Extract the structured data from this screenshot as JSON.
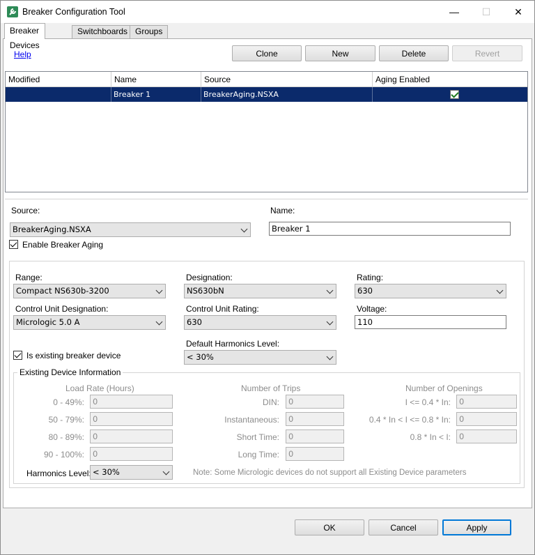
{
  "window": {
    "title": "Breaker Configuration Tool",
    "min_glyph": "—",
    "max_glyph": "☐",
    "close_glyph": "✕"
  },
  "tabs": [
    "Breaker Devices",
    "Switchboards",
    "Groups"
  ],
  "toolbar": {
    "help": "Help",
    "clone": "Clone",
    "new": "New",
    "delete": "Delete",
    "revert": "Revert"
  },
  "grid": {
    "columns": [
      "Modified",
      "Name",
      "Source",
      "Aging Enabled"
    ],
    "rows": [
      {
        "modified": "",
        "name": "Breaker 1",
        "source": "BreakerAging.NSXA",
        "aging_enabled": true
      }
    ]
  },
  "form": {
    "source_label": "Source:",
    "source_value": "BreakerAging.NSXA",
    "name_label": "Name:",
    "name_value": "Breaker 1",
    "enable_aging_label": "Enable Breaker Aging",
    "range_label": "Range:",
    "range_value": "Compact NS630b-3200",
    "designation_label": "Designation:",
    "designation_value": "NS630bN",
    "rating_label": "Rating:",
    "rating_value": "630",
    "cu_designation_label": "Control Unit Designation:",
    "cu_designation_value": "Micrologic 5.0 A",
    "cu_rating_label": "Control Unit Rating:",
    "cu_rating_value": "630",
    "voltage_label": "Voltage:",
    "voltage_value": "110",
    "existing_label": "Is existing breaker device",
    "harmonics_default_label": "Default Harmonics Level:",
    "harmonics_default_value": "< 30%"
  },
  "existing": {
    "title": "Existing Device Information",
    "load_rate_header": "Load Rate (Hours)",
    "load_rate": [
      {
        "label": "0 - 49%:",
        "value": "0"
      },
      {
        "label": "50 - 79%:",
        "value": "0"
      },
      {
        "label": "80 - 89%:",
        "value": "0"
      },
      {
        "label": "90 - 100%:",
        "value": "0"
      }
    ],
    "trips_header": "Number of Trips",
    "trips": [
      {
        "label": "DIN:",
        "value": "0"
      },
      {
        "label": "Instantaneous:",
        "value": "0"
      },
      {
        "label": "Short Time:",
        "value": "0"
      },
      {
        "label": "Long Time:",
        "value": "0"
      }
    ],
    "openings_header": "Number of Openings",
    "openings": [
      {
        "label": "I <= 0.4 * In:",
        "value": "0"
      },
      {
        "label": "0.4 * In < I <= 0.8 * In:",
        "value": "0"
      },
      {
        "label": "0.8 * In < I:",
        "value": "0"
      }
    ],
    "harmonics_label": "Harmonics Level:",
    "harmonics_value": "< 30%",
    "note": "Note: Some Micrologic devices do not support all Existing Device parameters"
  },
  "footer": {
    "ok": "OK",
    "cancel": "Cancel",
    "apply": "Apply"
  }
}
